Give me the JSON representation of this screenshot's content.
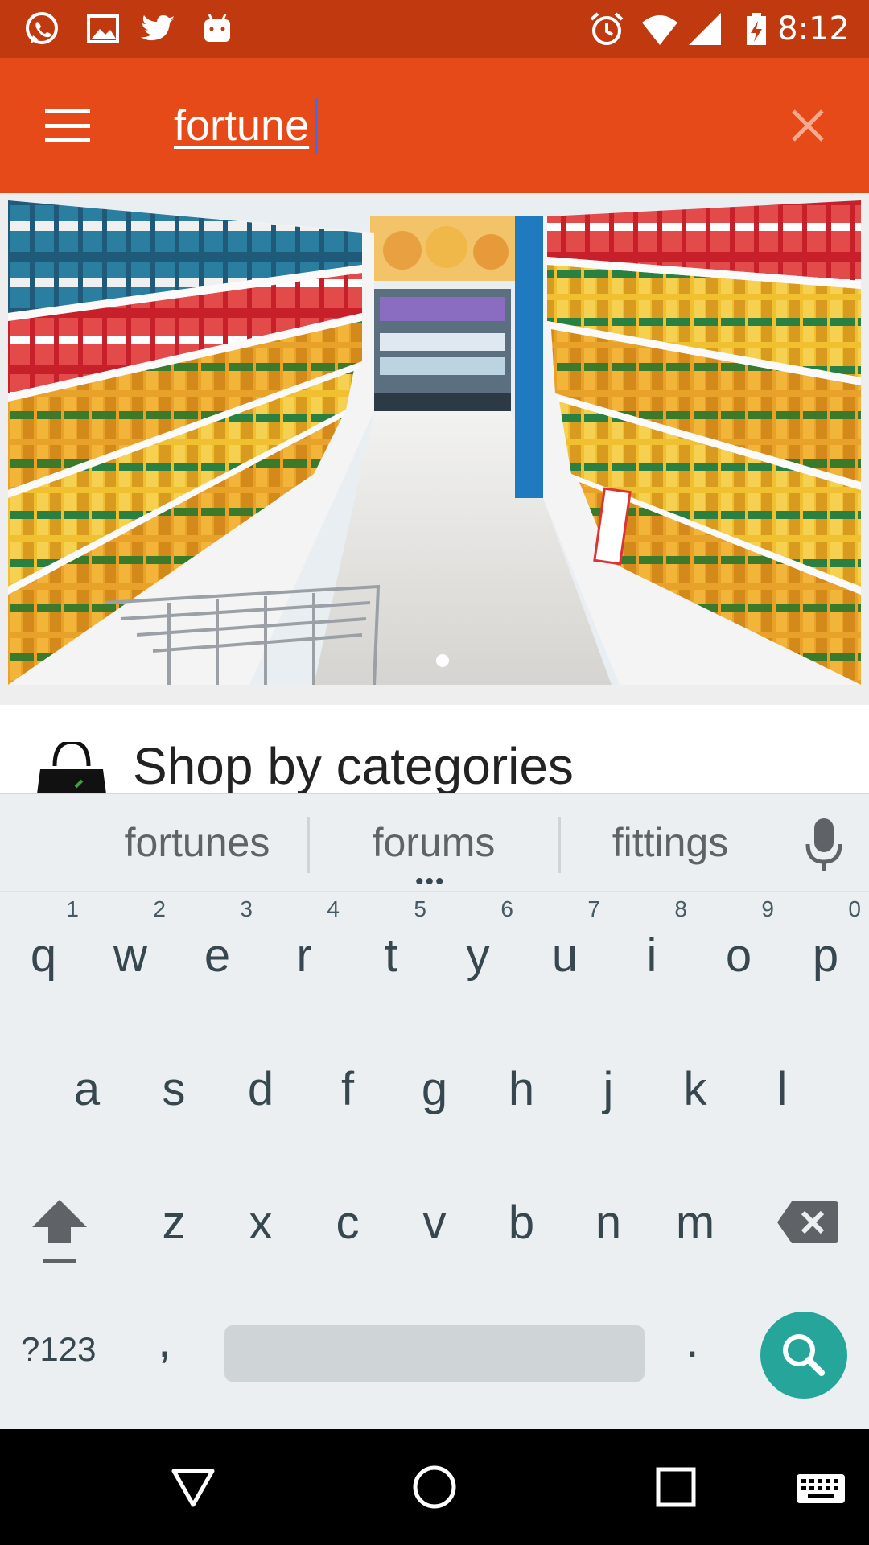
{
  "status_bar": {
    "time": "8:12",
    "left_icons": [
      "whatsapp-icon",
      "gallery-icon",
      "twitter-icon",
      "android-icon"
    ],
    "right_icons": [
      "alarm-icon",
      "wifi-icon",
      "signal-icon",
      "battery-charging-icon"
    ]
  },
  "app_bar": {
    "search_value": "fortune",
    "color": "#e64a19",
    "status_color": "#c0390f"
  },
  "banner": {
    "slide_indicator": "1 dot (active)"
  },
  "categories": {
    "title": "Shop by categories"
  },
  "keyboard": {
    "suggestions": [
      "fortunes",
      "forums",
      "fittings"
    ],
    "more_dots": "•••",
    "row1": [
      {
        "ch": "q",
        "num": "1"
      },
      {
        "ch": "w",
        "num": "2"
      },
      {
        "ch": "e",
        "num": "3"
      },
      {
        "ch": "r",
        "num": "4"
      },
      {
        "ch": "t",
        "num": "5"
      },
      {
        "ch": "y",
        "num": "6"
      },
      {
        "ch": "u",
        "num": "7"
      },
      {
        "ch": "i",
        "num": "8"
      },
      {
        "ch": "o",
        "num": "9"
      },
      {
        "ch": "p",
        "num": "0"
      }
    ],
    "row2": [
      "a",
      "s",
      "d",
      "f",
      "g",
      "h",
      "j",
      "k",
      "l"
    ],
    "row3": [
      "z",
      "x",
      "c",
      "v",
      "b",
      "n",
      "m"
    ],
    "symbols_label": "?123",
    "comma": ",",
    "period": ".",
    "accent_color": "#26a69a"
  },
  "nav_bar": {
    "buttons": [
      "back-icon",
      "home-icon",
      "recents-icon",
      "keyboard-icon"
    ]
  }
}
